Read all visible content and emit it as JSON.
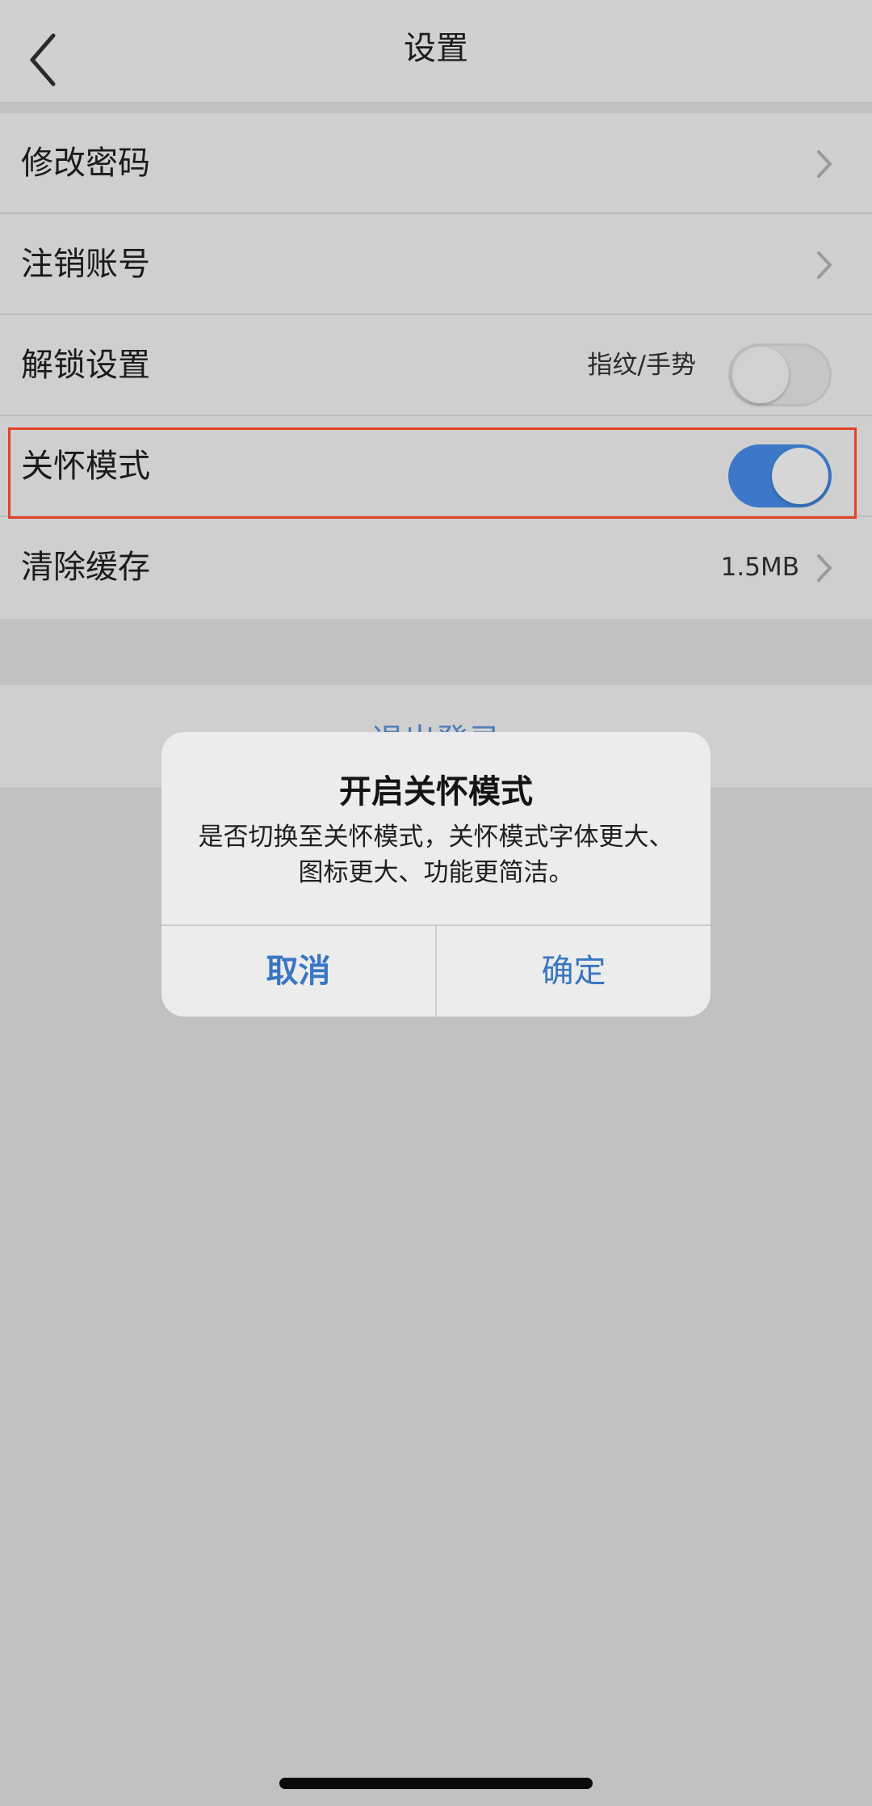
{
  "header": {
    "title": "设置"
  },
  "settings": {
    "items": [
      {
        "label": "修改密码"
      },
      {
        "label": "注销账号"
      },
      {
        "label": "解锁设置",
        "value": "指纹/手势",
        "toggle": "off"
      },
      {
        "label": "关怀模式",
        "toggle": "on"
      },
      {
        "label": "清除缓存",
        "value": "1.5MB"
      }
    ]
  },
  "logout": {
    "label": "退出登录"
  },
  "dialog": {
    "title": "开启关怀模式",
    "message": "是否切换至关怀模式，关怀模式字体更大、图标更大、功能更简洁。",
    "cancel_label": "取消",
    "confirm_label": "确定"
  },
  "colors": {
    "accent": "#3b78c7",
    "highlight": "#e5402a",
    "overlay": "#c1c1c4"
  }
}
